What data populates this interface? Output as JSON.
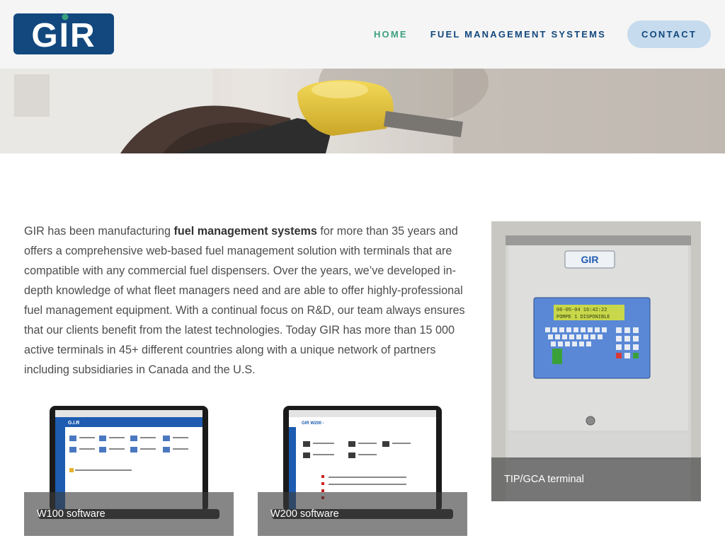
{
  "header": {
    "logo_text": "GIR",
    "nav": {
      "home": "HOME",
      "fuel_management_systems": "FUEL MANAGEMENT SYSTEMS",
      "contact": "CONTACT"
    }
  },
  "colors": {
    "header_bg": "#f5f5f5",
    "brand_blue": "#12487e",
    "brand_green": "#3aa17e",
    "contact_pill": "#c6dbed",
    "body_text": "#4d4d4d"
  },
  "intro": {
    "part1": "GIR has been manufacturing ",
    "bold": "fuel management systems",
    "part2": " for more than 35 years and offers a comprehensive web-based fuel management solution with terminals that are compatible with any commercial fuel dispensers. Over the years, we’ve developed in-depth knowledge of what fleet managers need and are able to offer highly-professional fuel management equipment. With a continual focus on R&D, our team always ensures that our clients benefit from the latest technologies. Today GIR has more than 15 000 active terminals in 45+ different countries along with a unique network of partners including subsidiaries in Canada and the U.S."
  },
  "cards": {
    "w100": {
      "caption": "W100 software",
      "screen_title": "G.I.R"
    },
    "w200": {
      "caption": "W200 software",
      "screen_title": "GIR W200 -"
    },
    "tip": {
      "caption": "TIP/GCA terminal",
      "device_logo": "GIR",
      "lcd_line1": "06-05-04 16:42:22",
      "lcd_line2": "POMPE 1 DISPONIBLE"
    }
  },
  "icons": [
    "gir-logo-icon",
    "fuel-nozzle-hero-image",
    "laptop-icon",
    "terminal-image"
  ]
}
